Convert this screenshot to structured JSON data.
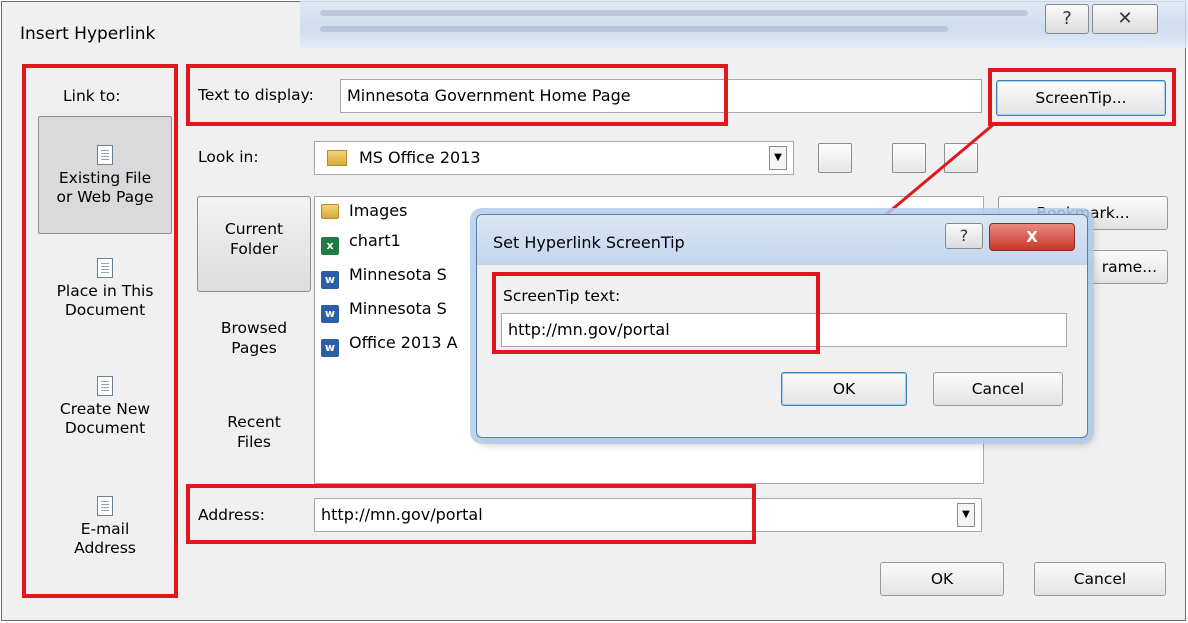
{
  "window": {
    "title": "Insert Hyperlink",
    "help_icon": "?",
    "close_icon": "✕"
  },
  "link_to": {
    "heading": "Link to:",
    "items": [
      {
        "line1": "Existing File",
        "line2": "or Web Page",
        "icon": "web-page-icon"
      },
      {
        "line1": "Place in This",
        "line2": "Document",
        "icon": "bookmark-doc-icon"
      },
      {
        "line1": "Create New",
        "line2": "Document",
        "icon": "new-doc-icon"
      },
      {
        "line1": "E-mail",
        "line2": "Address",
        "icon": "email-icon"
      }
    ]
  },
  "text_to_display": {
    "label": "Text to display:",
    "value": "Minnesota Government Home Page"
  },
  "screentip_button": "ScreenTip...",
  "look_in": {
    "label": "Look in:",
    "value": "MS Office 2013"
  },
  "side_tabs": [
    {
      "line1": "Current",
      "line2": "Folder"
    },
    {
      "line1": "Browsed",
      "line2": "Pages"
    },
    {
      "line1": "Recent",
      "line2": "Files"
    }
  ],
  "files": [
    {
      "name": "Images",
      "type": "folder"
    },
    {
      "name": "chart1",
      "type": "excel"
    },
    {
      "name": "Minnesota S",
      "type": "word"
    },
    {
      "name": "Minnesota S",
      "type": "word"
    },
    {
      "name": "Office 2013 A",
      "type": "word"
    }
  ],
  "right_buttons": {
    "bookmark": "Bookmark...",
    "target_frame": "rame..."
  },
  "address": {
    "label": "Address:",
    "value": "http://mn.gov/portal"
  },
  "footer": {
    "ok": "OK",
    "cancel": "Cancel"
  },
  "screentip_dialog": {
    "title": "Set Hyperlink ScreenTip",
    "help_icon": "?",
    "close_icon": "X",
    "field_label": "ScreenTip text:",
    "field_value": "http://mn.gov/portal",
    "ok": "OK",
    "cancel": "Cancel"
  },
  "colors": {
    "highlight_red": "#e0171d",
    "dialog_bg": "#f0f0f0",
    "default_button_border": "#3c7fb1"
  }
}
